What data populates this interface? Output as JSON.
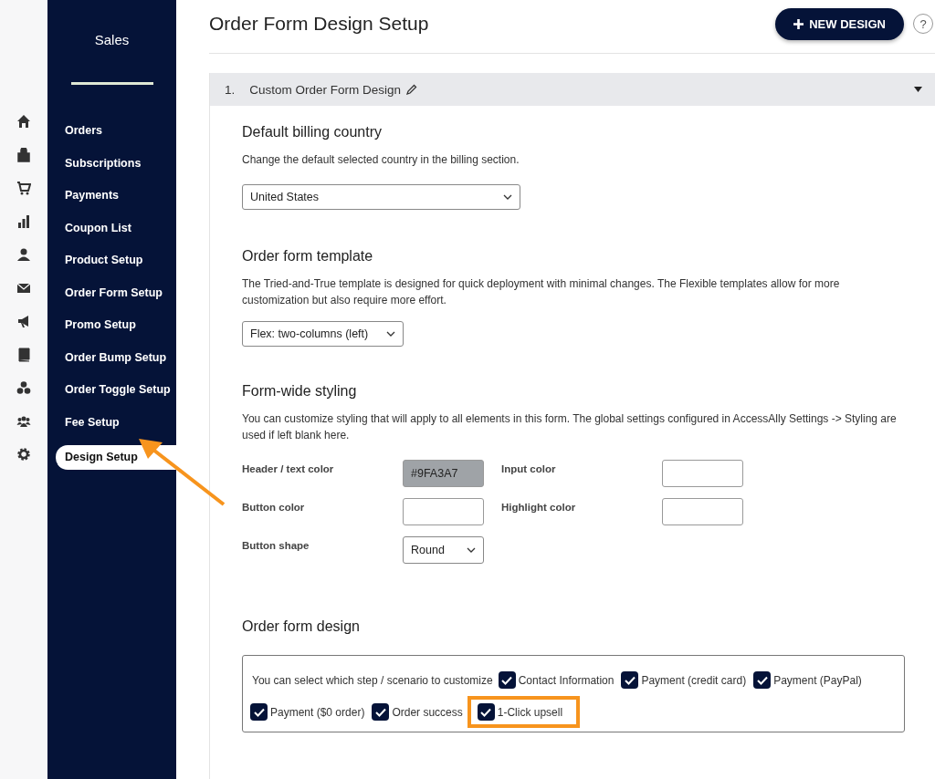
{
  "sidebar": {
    "title": "Sales",
    "items": [
      {
        "label": "Orders",
        "selected": false
      },
      {
        "label": "Subscriptions",
        "selected": false
      },
      {
        "label": "Payments",
        "selected": false
      },
      {
        "label": "Coupon List",
        "selected": false
      },
      {
        "label": "Product Setup",
        "selected": false
      },
      {
        "label": "Order Form Setup",
        "selected": false
      },
      {
        "label": "Promo Setup",
        "selected": false
      },
      {
        "label": "Order Bump Setup",
        "selected": false
      },
      {
        "label": "Order Toggle Setup",
        "selected": false
      },
      {
        "label": "Fee Setup",
        "selected": false
      },
      {
        "label": "Design Setup",
        "selected": true
      }
    ]
  },
  "page": {
    "title": "Order Form Design Setup",
    "new_button": "NEW DESIGN",
    "help": "?"
  },
  "panel": {
    "number": "1.",
    "title": "Custom Order Form Design",
    "expanded": true,
    "billing": {
      "heading": "Default billing country",
      "description": "Change the default selected country in the billing section.",
      "value": "United States"
    },
    "template": {
      "heading": "Order form template",
      "description": "The Tried-and-True template is designed for quick deployment with minimal changes. The Flexible templates allow for more customization but also require more effort.",
      "value": "Flex: two-columns (left)"
    },
    "styling": {
      "heading": "Form-wide styling",
      "description": "You can customize styling that will apply to all elements in this form. The global settings configured in AccessAlly Settings -> Styling are used if left blank here.",
      "fields": [
        {
          "label": "Header / text color",
          "kind": "color",
          "value": "#9FA3A7",
          "color": "#9fa3a7"
        },
        {
          "label": "Input color",
          "kind": "color"
        },
        {
          "label": "Button color",
          "kind": "color"
        },
        {
          "label": "Highlight color",
          "kind": "color"
        },
        {
          "label": "Button shape",
          "kind": "select",
          "value": "Round"
        }
      ]
    },
    "design": {
      "heading": "Order form design",
      "intro": "You can select which step / scenario to customize",
      "steps": [
        {
          "label": "Contact Information",
          "checked": true
        },
        {
          "label": "Payment (credit card)",
          "checked": true
        },
        {
          "label": "Payment (PayPal)",
          "checked": true
        },
        {
          "label": "Payment ($0 order)",
          "checked": true
        },
        {
          "label": "Order success",
          "checked": true
        },
        {
          "label": "1-Click upsell",
          "checked": true,
          "highlighted": true
        }
      ]
    }
  }
}
